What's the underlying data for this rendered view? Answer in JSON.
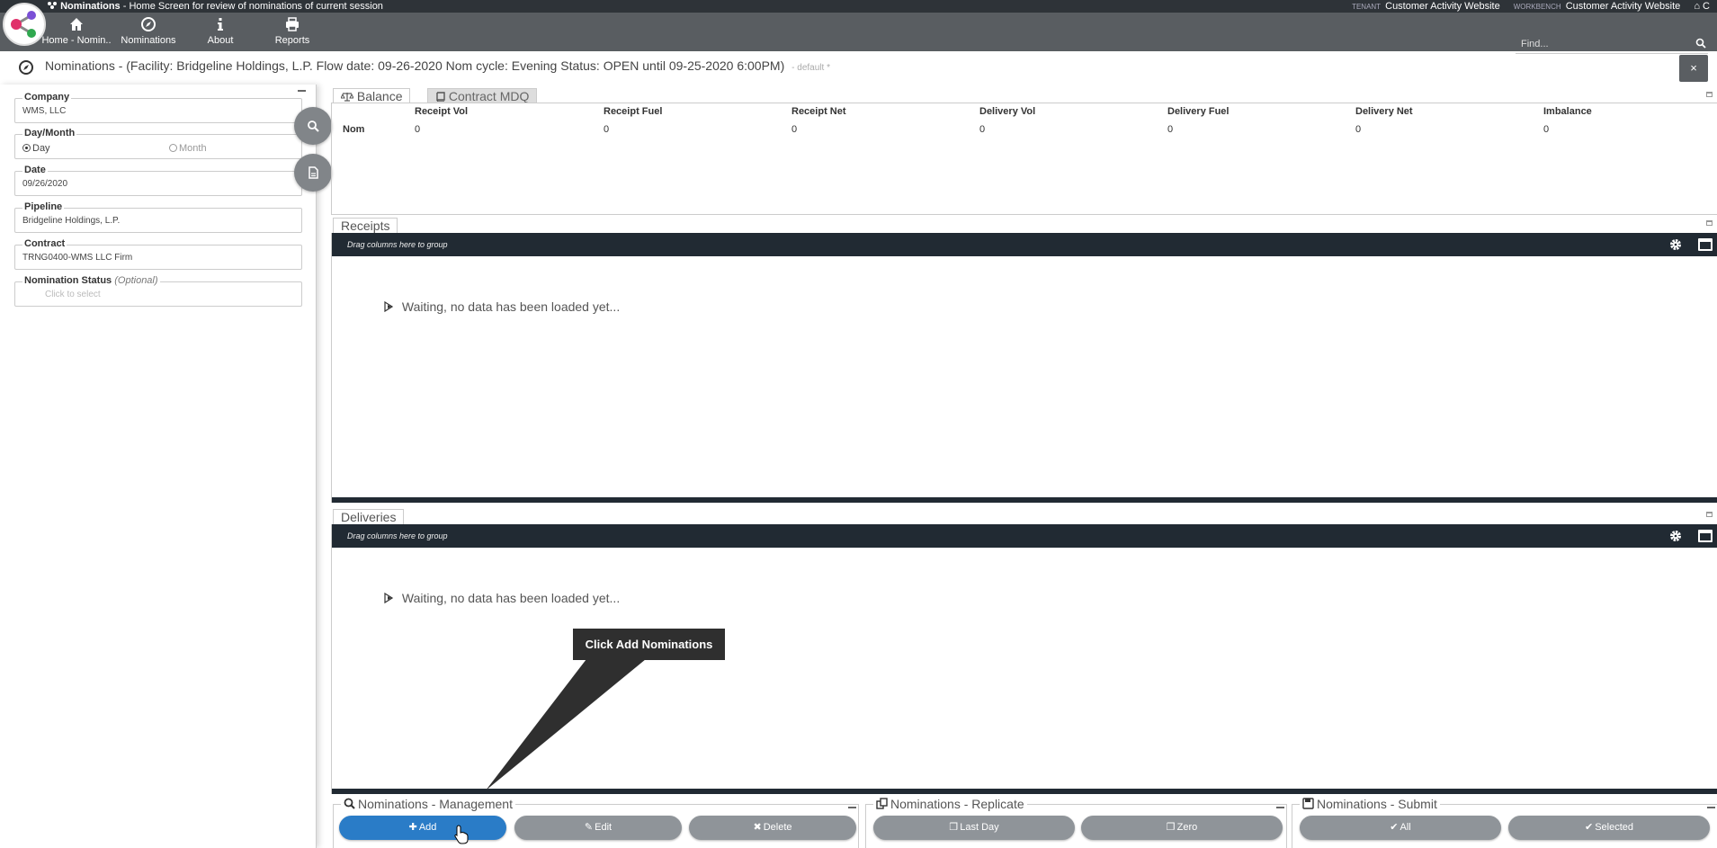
{
  "app": {
    "name": "Nominations",
    "subtitle": "- Home Screen for review of nominations of current session",
    "tenant_tag": "TENANT",
    "tenant_value": "Customer Activity Website",
    "workbench_tag": "WORKBENCH",
    "workbench_value": "Customer Activity Website",
    "edge_text": "C"
  },
  "nav": {
    "items": [
      {
        "label": "Home - Nomin..",
        "icon": "home-icon"
      },
      {
        "label": "Nominations",
        "icon": "compass-icon"
      },
      {
        "label": "About",
        "icon": "info-icon"
      },
      {
        "label": "Reports",
        "icon": "print-icon"
      }
    ],
    "find_placeholder": "Find..."
  },
  "page": {
    "title": "Nominations - (Facility: Bridgeline Holdings, L.P. Flow date: 09-26-2020 Nom cycle: Evening Status: OPEN until 09-25-2020 6:00PM)",
    "default_label": "- default *",
    "close_label": "×"
  },
  "filters": {
    "company": {
      "label": "Company",
      "value": "WMS, LLC"
    },
    "daymonth": {
      "label": "Day/Month",
      "day": "Day",
      "month": "Month",
      "selected": "Day"
    },
    "date": {
      "label": "Date",
      "value": "09/26/2020"
    },
    "pipeline": {
      "label": "Pipeline",
      "value": "Bridgeline Holdings, L.P."
    },
    "contract": {
      "label": "Contract",
      "value": "TRNG0400-WMS LLC Firm"
    },
    "status": {
      "label": "Nomination Status",
      "optional": "(Optional)",
      "placeholder": "Click to select"
    }
  },
  "balance": {
    "tabs": [
      "Balance",
      "Contract MDQ"
    ],
    "active_tab": "Balance",
    "columns": [
      "Receipt Vol",
      "Receipt Fuel",
      "Receipt Net",
      "Delivery Vol",
      "Delivery Fuel",
      "Delivery Net",
      "Imbalance"
    ],
    "rows": [
      {
        "label": "Nom",
        "values": [
          "0",
          "0",
          "0",
          "0",
          "0",
          "0",
          "0"
        ]
      }
    ]
  },
  "receipts": {
    "title": "Receipts",
    "drag_text": "Drag columns here to group",
    "waiting_text": "Waiting, no data has been loaded yet..."
  },
  "deliveries": {
    "title": "Deliveries",
    "drag_text": "Drag columns here to group",
    "waiting_text": "Waiting, no data has been loaded yet..."
  },
  "callout": {
    "text": "Click Add Nominations"
  },
  "management": {
    "title": "Nominations - Management",
    "add": "Add",
    "edit": "Edit",
    "delete": "Delete"
  },
  "replicate": {
    "title": "Nominations - Replicate",
    "last_day": "Last Day",
    "zero": "Zero"
  },
  "submit": {
    "title": "Nominations - Submit",
    "all": "All",
    "selected": "Selected"
  },
  "colors": {
    "accent": "#2a7cc7",
    "header_dark": "#2e3338",
    "navbar": "#595d61",
    "grid_header": "#212a33",
    "button_gray": "#8f9499"
  }
}
